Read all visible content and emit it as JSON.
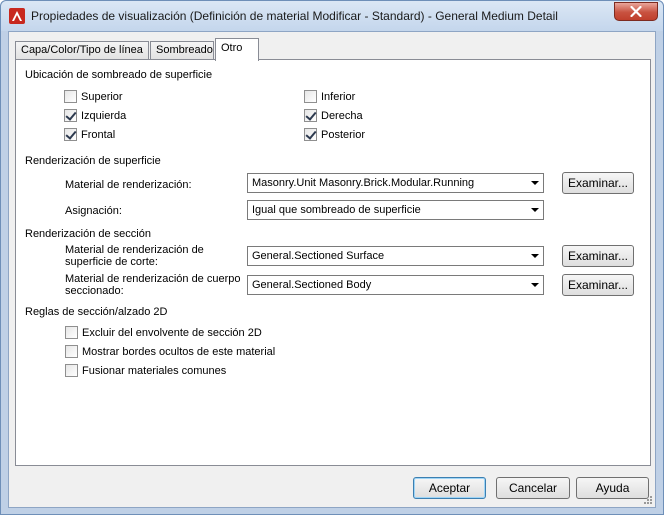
{
  "window": {
    "title": "Propiedades de visualización (Definición de material Modificar - Standard) - General Medium Detail"
  },
  "tabs": [
    {
      "label": "Capa/Color/Tipo de línea",
      "active": false
    },
    {
      "label": "Sombreado",
      "active": false
    },
    {
      "label": "Otro",
      "active": true
    }
  ],
  "surface_hatch": {
    "heading": "Ubicación de sombreado de superficie",
    "options": [
      {
        "label": "Superior",
        "checked": false
      },
      {
        "label": "Inferior",
        "checked": false
      },
      {
        "label": "Izquierda",
        "checked": true
      },
      {
        "label": "Derecha",
        "checked": true
      },
      {
        "label": "Frontal",
        "checked": true
      },
      {
        "label": "Posterior",
        "checked": true
      }
    ]
  },
  "surface_render": {
    "heading": "Renderización de superficie",
    "material_label": "Material de renderización:",
    "material_value": "Masonry.Unit Masonry.Brick.Modular.Running",
    "browse_label": "Examinar...",
    "mapping_label": "Asignación:",
    "mapping_value": "Igual que sombreado de superficie"
  },
  "section_render": {
    "heading": "Renderización de sección",
    "cut_label_1": "Material de renderización de",
    "cut_label_2": "superficie de corte:",
    "cut_value": "General.Sectioned Surface",
    "body_label_1": "Material de renderización de cuerpo",
    "body_label_2": "seccionado:",
    "body_value": "General.Sectioned Body",
    "browse_label": "Examinar..."
  },
  "section_rules": {
    "heading": "Reglas de sección/alzado 2D",
    "options": [
      {
        "label": "Excluir del envolvente de sección 2D",
        "checked": false
      },
      {
        "label": "Mostrar bordes ocultos de este material",
        "checked": false
      },
      {
        "label": "Fusionar materiales comunes",
        "checked": false
      }
    ]
  },
  "footer": {
    "ok": "Aceptar",
    "cancel": "Cancelar",
    "help": "Ayuda"
  },
  "colors": {
    "accent": "#3c7fb1",
    "close": "#c85240",
    "app_icon": "#c8281e"
  },
  "icons": [
    "autocad-app-icon",
    "close-icon",
    "dropdown-arrow-icon",
    "resize-grip-icon"
  ]
}
